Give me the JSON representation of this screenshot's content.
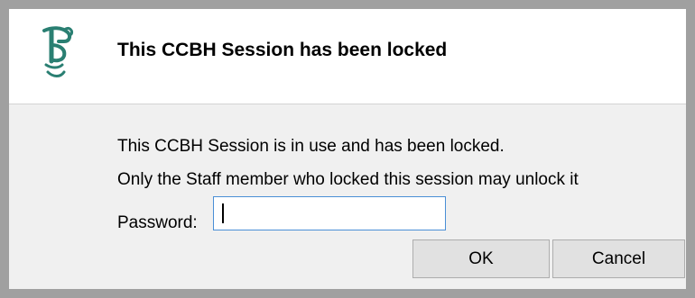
{
  "dialog": {
    "title": "This CCBH Session has been locked",
    "logo_icon": "ccbh-logo-icon",
    "message_line1": "This CCBH Session is in use and has been locked.",
    "message_line2": "Only the Staff member who locked this session may unlock it",
    "password_label": "Password:",
    "password_value": "",
    "ok_label": "OK",
    "cancel_label": "Cancel"
  },
  "colors": {
    "frame": "#a0a0a0",
    "header_bg": "#ffffff",
    "body_bg": "#f0f0f0",
    "logo": "#2a7f72",
    "input_focus_border": "#4a8fd6",
    "button_bg": "#e1e1e1"
  }
}
